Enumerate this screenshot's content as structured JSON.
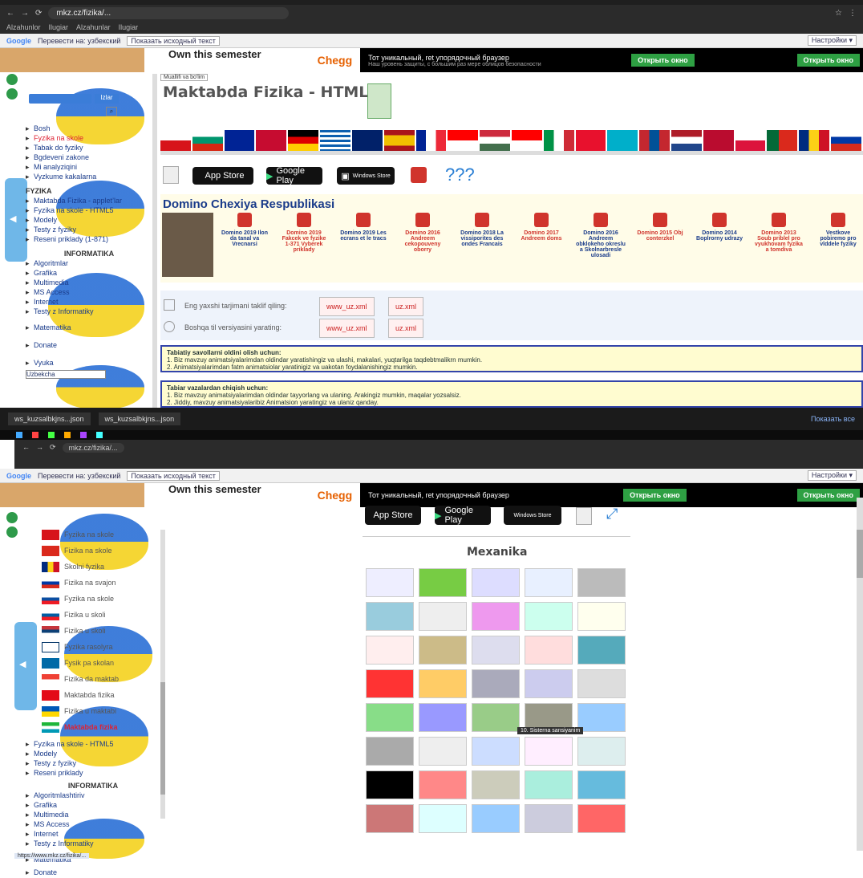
{
  "screen1": {
    "browser": {
      "url": "mkz.cz/fizika/...",
      "bookmarks": [
        "Alzahunlor",
        "Ilugiar",
        "Alzahunlar",
        "Ilugiar"
      ],
      "translate": {
        "brand": "Google",
        "text": "Перевести на: узбекский",
        "show_original": "Показать исходный текст",
        "settings": "Настройки ▾"
      }
    },
    "ad": {
      "own": "Own this semester",
      "chegg": "Chegg",
      "desc": "Тот уникальный, ret упорядочный браузер",
      "desc2": "Наш уровень защиты, с большим раз мере облицов безопасности",
      "button": "Открыть окно",
      "right_button": "Открыть окно"
    },
    "breadcrumb": "Muallifi va bo'lim",
    "page_title": "Maktabda Fizika - HTML5",
    "stores": {
      "appstore": "App Store",
      "googleplay": "Google Play",
      "windows": "Windows Store",
      "qqq": "???"
    },
    "domino_title": "Domino Chexiya Respublikasi",
    "domino": [
      {
        "t": "Domino 2019 Ilon da tanal va Vrecnarsi",
        "red": false
      },
      {
        "t": "Domino 2019 Fakcek ve fyzike 1-371 Vyberek priklady",
        "red": true
      },
      {
        "t": "Domino 2019 Les ecrans et le tracs",
        "red": false
      },
      {
        "t": "Domino 2016 Andreem cekopouveny oborry",
        "red": true
      },
      {
        "t": "Domino 2018 La vissiporites des ondes Francais",
        "red": false
      },
      {
        "t": "Domino 2017 Andreem doms",
        "red": true
      },
      {
        "t": "Domino 2016 Andreem obklokeho okreslu a Skolnarbresle ulosadi",
        "red": false
      },
      {
        "t": "Domino 2015 Obj conterzkel",
        "red": true
      },
      {
        "t": "Domino 2014 Boplrorny udrazy",
        "red": false
      },
      {
        "t": "Domino 2013 Soub priblel pro vyukhovam fyzika a tomdiva",
        "red": true
      },
      {
        "t": "Vestkove pobiremo pro vlddele fyziky",
        "red": false
      }
    ],
    "form": {
      "line1": "Eng yaxshi tarjimani taklif qiling:",
      "line2": "Boshqa til versiyasini yarating:",
      "b1": "www_uz.xml",
      "b2": "uz.xml",
      "b3": "www_uz.xml",
      "b4": "uz.xml"
    },
    "note1": {
      "title": "Tabiatiy savollarni oldini olish uchun:",
      "l1": "1. Biz mavzuy animatsiyalarimdan oldindar yaratishingiz va ulashi, makalari, yuqtarilga taqdebtmalikrn mumkin.",
      "l2": "2. Animatsiyalarimdan fatm animatsiolar yaratinigiz va uakotan foydalanishingiz mumkin."
    },
    "note2": {
      "title": "Tabiar vazalardan chiqish uchun:",
      "l1": "1. Biz mavzuy animatsiyalarimdan oldindar tayyorlang va ulaning. Arakingiz mumkin, maqalar yozsalsiz.",
      "l2": "2. Jiddiy, mavzuy animatsiyalaribiz Animatsion yaratingiz va ulaniz qanday."
    },
    "sidebar": {
      "search_btn": "Izlar",
      "items": [
        "Bosh",
        "Fyzika na skole",
        "Tabak do fyziky",
        "Bgdeveni zakone",
        "Mi analyziqini",
        "Vyzkume kakalarna"
      ],
      "fyzika_head": "FYZIKA",
      "fyzika": [
        "Maktabda Fizika - applet’lar",
        "Fyzika na skole - HTML5",
        "Modely",
        "Testy z fyziky",
        "Reseni priklady (1-871)"
      ],
      "info_head": "INFORMATIKA",
      "info": [
        "Algoritmlar",
        "Grafika",
        "Multimedia",
        "MS Access",
        "Internet",
        "Testy z Informatiky"
      ],
      "matematika": "Matematika",
      "donate": "Donate",
      "vyuka": "Vyuka",
      "lang": "Uzbekcha"
    },
    "taskbar": {
      "tab1": "ws_kuzsalbkjns...json",
      "tab2": "ws_kuzsalbkjns...json",
      "right": "Показать все"
    }
  },
  "screen2": {
    "browser": {
      "url": "mkz.cz/fizika/..."
    },
    "ad": {
      "own": "Own this semester",
      "chegg": "Chegg",
      "desc": "Тот уникальный, ret упорядочный браузер",
      "button": "Открыть окно",
      "right_button": "Открыть окно"
    },
    "stores": {
      "appstore": "App Store",
      "googleplay": "Google Play",
      "windows": "Windows Store"
    },
    "section_title": "Mexanika",
    "tooltip": "10. Sisterna sansiyanim",
    "sidebar": {
      "langs": [
        "Fyzika na skole",
        "Fizika na skole",
        "Skolni fyzika",
        "Fizika na svajon",
        "Fyzika na skole",
        "Fizika u skoli",
        "Fizika u skoli",
        "Fyzika rasolyra",
        "Fysik pa skolan",
        "Fizika da maktab",
        "Maktabda fizika",
        "Fizika u maktabi",
        "Maktabda fizika"
      ],
      "active": "Maktabda fizika",
      "fyzika": [
        "Fyzika na skole - HTML5",
        "Modely",
        "Testy z fyziky",
        "Reseni priklady"
      ],
      "info_head": "INFORMATIKA",
      "info": [
        "Algoritmlashtiriv",
        "Grafika",
        "Multimedia",
        "MS Access",
        "Internet",
        "Testy z Informatiky"
      ],
      "matematika": "Matematika",
      "donate": "Donate"
    },
    "status_url": "https://www.mkz.cz/fizika/..."
  }
}
